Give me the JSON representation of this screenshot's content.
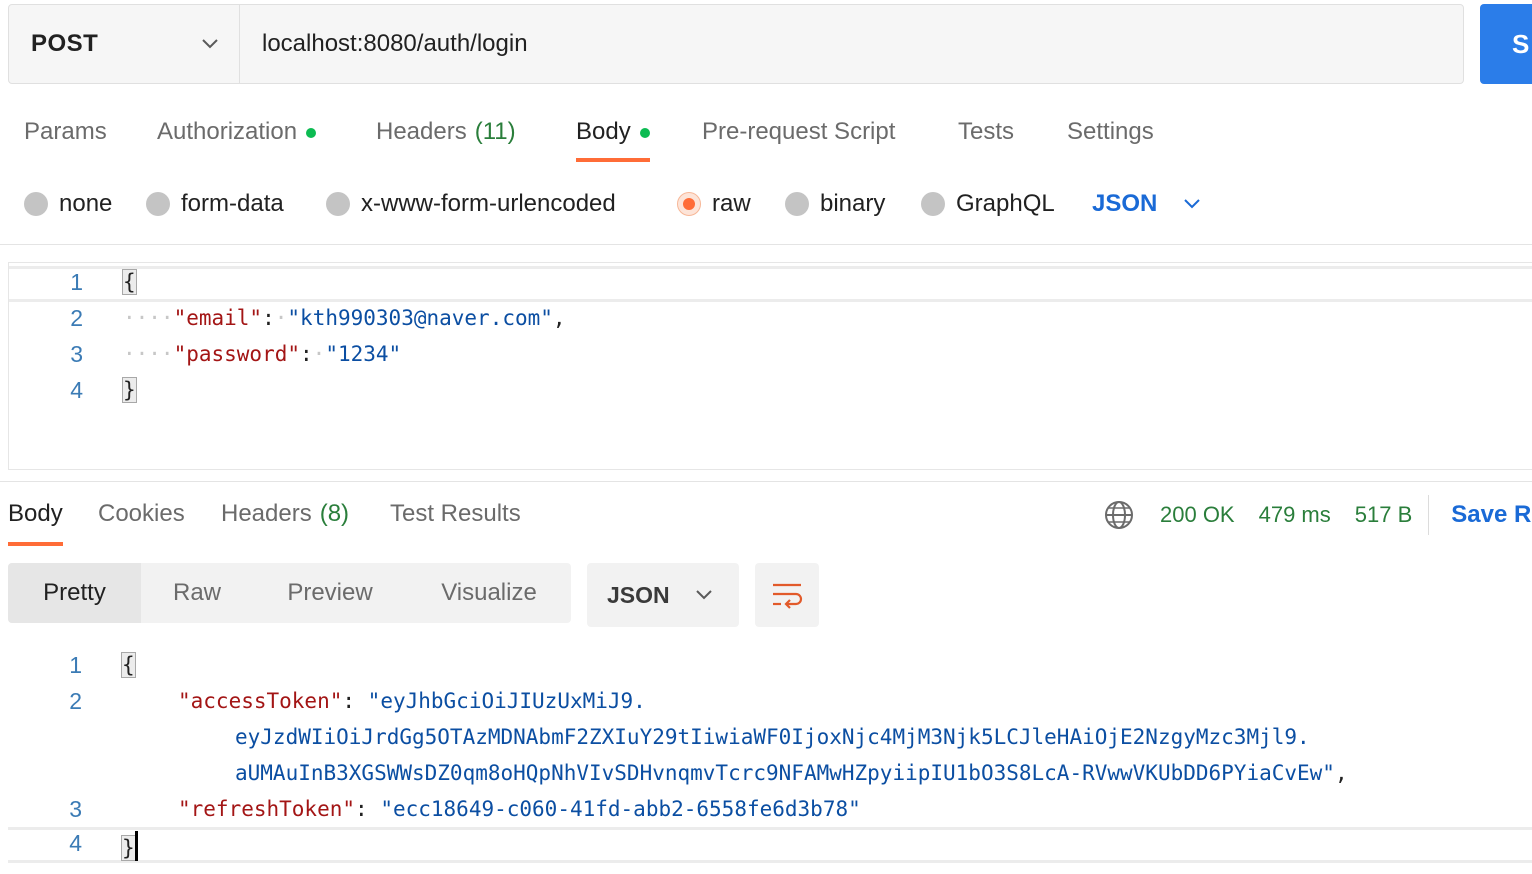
{
  "request": {
    "method": "POST",
    "url": "localhost:8080/auth/login",
    "send_label": "S"
  },
  "request_tabs": [
    {
      "label": "Params"
    },
    {
      "label": "Authorization"
    },
    {
      "label": "Headers",
      "count": "(11)"
    },
    {
      "label": "Body"
    },
    {
      "label": "Pre-request Script"
    },
    {
      "label": "Tests"
    },
    {
      "label": "Settings"
    }
  ],
  "body_types": [
    {
      "label": "none"
    },
    {
      "label": "form-data"
    },
    {
      "label": "x-www-form-urlencoded"
    },
    {
      "label": "raw",
      "selected": true
    },
    {
      "label": "binary"
    },
    {
      "label": "GraphQL"
    }
  ],
  "body_format": "JSON",
  "request_body": {
    "line_numbers": [
      "1",
      "2",
      "3",
      "4"
    ],
    "open_brace": "{",
    "close_brace": "}",
    "email_key": "\"email\"",
    "email_value": "\"kth990303@naver.com\"",
    "password_key": "\"password\"",
    "password_value": "\"1234\""
  },
  "response_tabs": [
    {
      "label": "Body"
    },
    {
      "label": "Cookies"
    },
    {
      "label": "Headers",
      "count": "(8)"
    },
    {
      "label": "Test Results"
    }
  ],
  "response_status": {
    "status": "200 OK",
    "time": "479 ms",
    "size": "517 B",
    "save_label": "Save R"
  },
  "response_formats": [
    "Pretty",
    "Raw",
    "Preview",
    "Visualize"
  ],
  "response_format_type": "JSON",
  "response_body": {
    "line_numbers": [
      "1",
      "2",
      "3",
      "4"
    ],
    "open_brace": "{",
    "close_brace": "}",
    "access_key": "\"accessToken\"",
    "access_value_1": "\"eyJhbGciOiJIUzUxMiJ9.",
    "access_value_2": "eyJzdWIiOiJrdGg5OTAzMDNAbmF2ZXIuY29tIiwiaWF0IjoxNjc4MjM3Njk5LCJleHAiOjE2NzgyMzc3Mjl9.",
    "access_value_3": "aUMAuInB3XGSWWsDZ0qm8oHQpNhVIvSDHvnqmvTcrc9NFAMwHZpyiipIU1bO3S8LcA-RVwwVKUbDD6PYiaCvEw\"",
    "refresh_key": "\"refreshToken\"",
    "refresh_value": "\"ecc18649-c060-41fd-abb2-6558fe6d3b78\""
  },
  "colors": {
    "accent": "#ff6c37",
    "send": "#2b7de9",
    "link": "#1a6ad6",
    "status_ok": "#2a7e3b",
    "dot_green": "#0cbb52"
  },
  "icons": {
    "method_dropdown": "chevron-down-icon",
    "format_dropdown": "chevron-down-icon",
    "network": "globe-icon",
    "wrap": "wrap-lines-icon"
  }
}
